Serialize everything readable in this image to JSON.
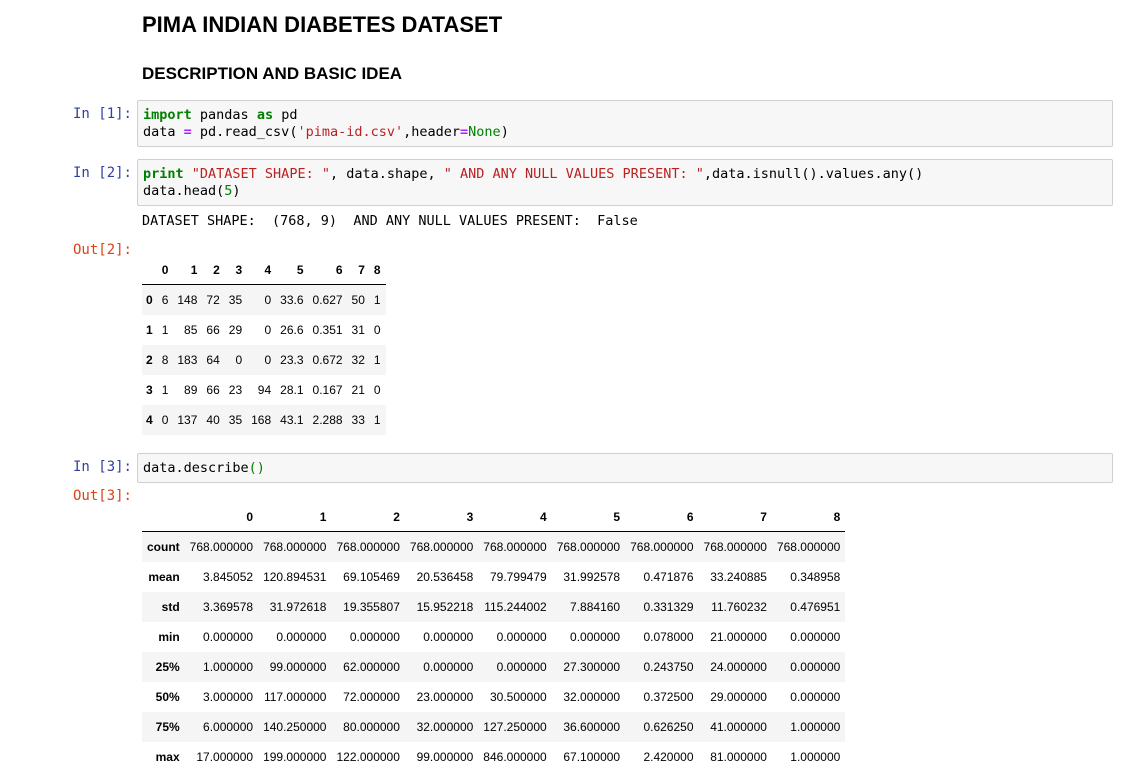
{
  "markdown": {
    "title": "PIMA INDIAN DIABETES DATASET",
    "subtitle": "DESCRIPTION AND BASIC IDEA"
  },
  "cells": {
    "c1": {
      "prompt": "In [1]:",
      "line1": {
        "t1": "import",
        "t2": " pandas ",
        "t3": "as",
        "t4": " pd"
      },
      "line2": {
        "t1": "data ",
        "t2": "=",
        "t3": " pd.read_csv(",
        "t4": "'pima-id.csv'",
        "t5": ",header",
        "t6": "=",
        "t7": "None",
        "t8": ")"
      }
    },
    "c2": {
      "prompt": "In [2]:",
      "line1": {
        "t1": "print",
        "t2": " ",
        "t3": "\"DATASET SHAPE: \"",
        "t4": ", data.shape, ",
        "t5": "\" AND ANY NULL VALUES PRESENT: \"",
        "t6": ",data.isnull().values.any()"
      },
      "line2": {
        "t1": "data.head(",
        "t2": "5",
        "t3": ")"
      },
      "stdout": "DATASET SHAPE:  (768, 9)  AND ANY NULL VALUES PRESENT:  False",
      "out_prompt": "Out[2]:",
      "table": {
        "columns": [
          "",
          "0",
          "1",
          "2",
          "3",
          "4",
          "5",
          "6",
          "7",
          "8"
        ],
        "rows": [
          [
            "0",
            "6",
            "148",
            "72",
            "35",
            "0",
            "33.6",
            "0.627",
            "50",
            "1"
          ],
          [
            "1",
            "1",
            "85",
            "66",
            "29",
            "0",
            "26.6",
            "0.351",
            "31",
            "0"
          ],
          [
            "2",
            "8",
            "183",
            "64",
            "0",
            "0",
            "23.3",
            "0.672",
            "32",
            "1"
          ],
          [
            "3",
            "1",
            "89",
            "66",
            "23",
            "94",
            "28.1",
            "0.167",
            "21",
            "0"
          ],
          [
            "4",
            "0",
            "137",
            "40",
            "35",
            "168",
            "43.1",
            "2.288",
            "33",
            "1"
          ]
        ]
      }
    },
    "c3": {
      "prompt": "In [3]:",
      "line1": {
        "t1": "data.describe",
        "t2": "()"
      },
      "out_prompt": "Out[3]:",
      "table": {
        "columns": [
          "",
          "0",
          "1",
          "2",
          "3",
          "4",
          "5",
          "6",
          "7",
          "8"
        ],
        "rows": [
          [
            "count",
            "768.000000",
            "768.000000",
            "768.000000",
            "768.000000",
            "768.000000",
            "768.000000",
            "768.000000",
            "768.000000",
            "768.000000"
          ],
          [
            "mean",
            "3.845052",
            "120.894531",
            "69.105469",
            "20.536458",
            "79.799479",
            "31.992578",
            "0.471876",
            "33.240885",
            "0.348958"
          ],
          [
            "std",
            "3.369578",
            "31.972618",
            "19.355807",
            "15.952218",
            "115.244002",
            "7.884160",
            "0.331329",
            "11.760232",
            "0.476951"
          ],
          [
            "min",
            "0.000000",
            "0.000000",
            "0.000000",
            "0.000000",
            "0.000000",
            "0.000000",
            "0.078000",
            "21.000000",
            "0.000000"
          ],
          [
            "25%",
            "1.000000",
            "99.000000",
            "62.000000",
            "0.000000",
            "0.000000",
            "27.300000",
            "0.243750",
            "24.000000",
            "0.000000"
          ],
          [
            "50%",
            "3.000000",
            "117.000000",
            "72.000000",
            "23.000000",
            "30.500000",
            "32.000000",
            "0.372500",
            "29.000000",
            "0.000000"
          ],
          [
            "75%",
            "6.000000",
            "140.250000",
            "80.000000",
            "32.000000",
            "127.250000",
            "36.600000",
            "0.626250",
            "41.000000",
            "1.000000"
          ],
          [
            "max",
            "17.000000",
            "199.000000",
            "122.000000",
            "99.000000",
            "846.000000",
            "67.100000",
            "2.420000",
            "81.000000",
            "1.000000"
          ]
        ]
      }
    }
  }
}
